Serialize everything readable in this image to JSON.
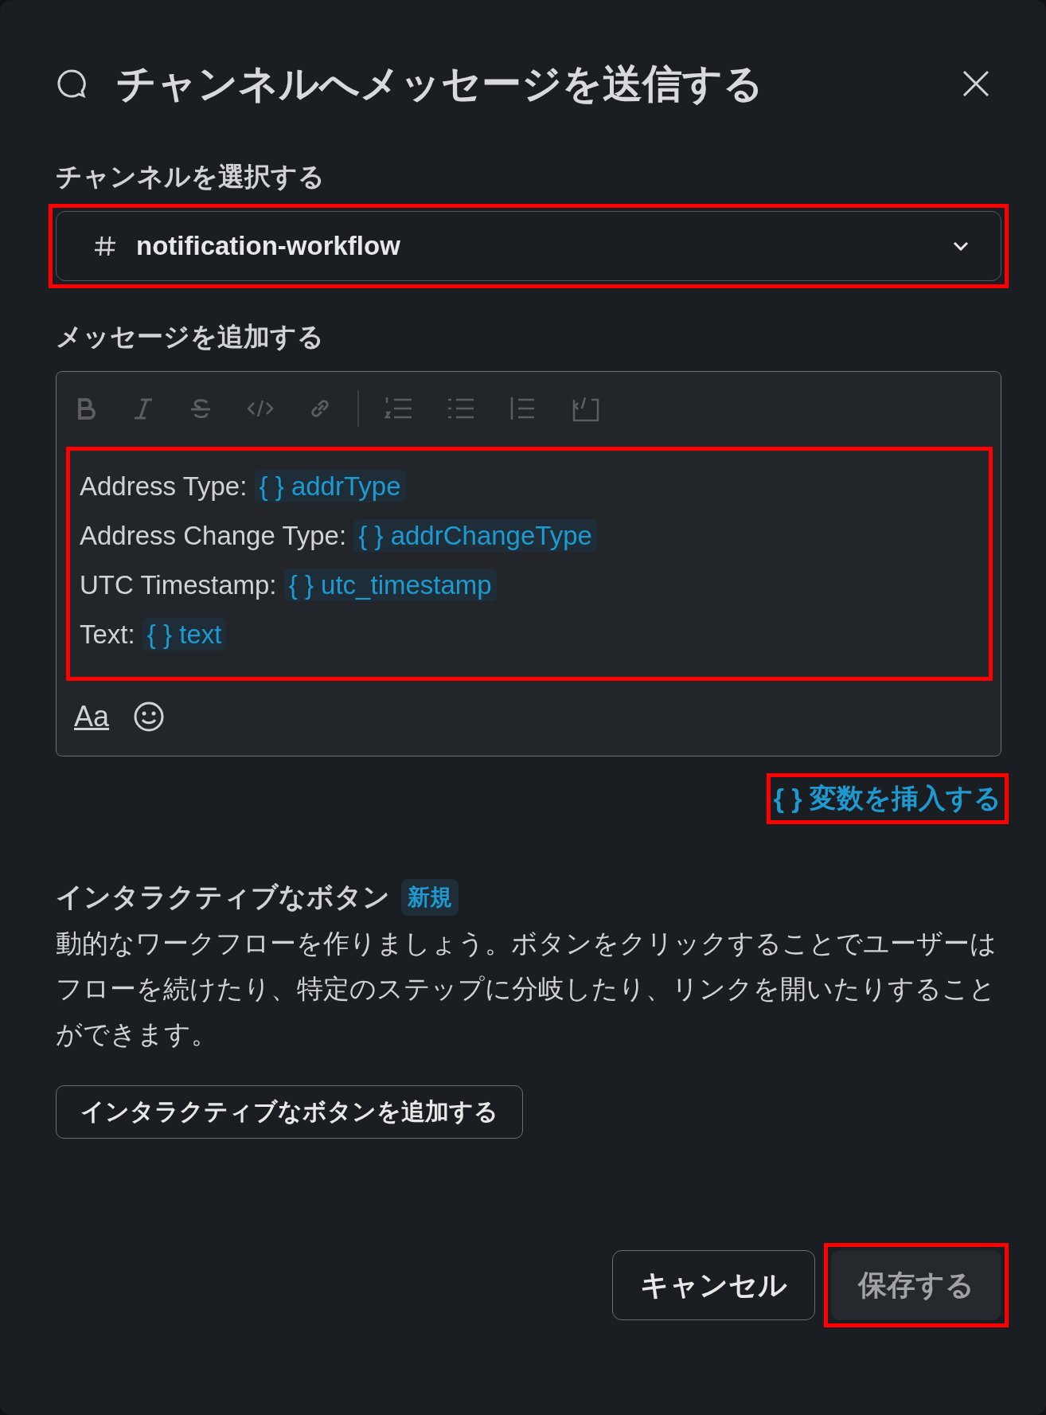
{
  "dialog": {
    "title": "チャンネルへメッセージを送信する"
  },
  "channel": {
    "label": "チャンネルを選択する",
    "value": "notification-workflow",
    "highlighted": true
  },
  "message": {
    "label": "メッセージを追加する",
    "highlighted": true,
    "lines": [
      {
        "label": "Address Type:",
        "icon": "{ }",
        "variable": "addrType"
      },
      {
        "label": "Address Change Type:",
        "icon": "{ }",
        "variable": "addrChangeType"
      },
      {
        "label": "UTC Timestamp:",
        "icon": "{ }",
        "variable": "utc_timestamp"
      },
      {
        "label": "Text:",
        "icon": "{ }",
        "variable": "text"
      }
    ],
    "format_button": "Aa"
  },
  "insert_variable": {
    "icon": "{ }",
    "label": "変数を挿入する",
    "highlighted": true
  },
  "interactive": {
    "heading": "インタラクティブなボタン",
    "badge": "新規",
    "description": "動的なワークフローを作りましょう。ボタンをクリックすることでユーザーはフローを続けたり、特定のステップに分岐したり、リンクを開いたりすることができます。",
    "button": "インタラクティブなボタンを追加する"
  },
  "footer": [
    {
      "label": "キャンセル",
      "kind": "secondary",
      "disabled": false,
      "highlighted": false
    },
    {
      "label": "保存する",
      "kind": "primary",
      "disabled": true,
      "highlighted": true
    }
  ]
}
